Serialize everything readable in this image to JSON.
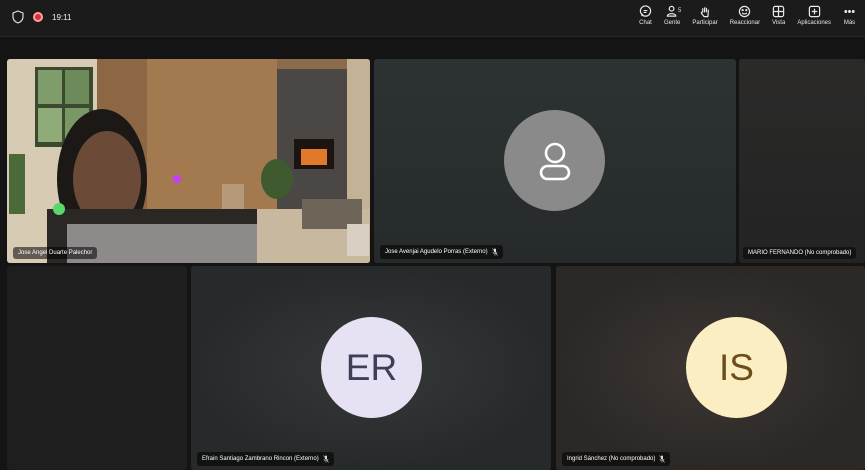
{
  "status": {
    "time": "19:11"
  },
  "toolbar": {
    "items": [
      {
        "label": "Chat",
        "icon": "chat-icon"
      },
      {
        "label": "Gente",
        "icon": "people-icon",
        "count": "5"
      },
      {
        "label": "Participar",
        "icon": "raise-hand-icon"
      },
      {
        "label": "Reaccionar",
        "icon": "react-icon"
      },
      {
        "label": "Vista",
        "icon": "view-icon"
      },
      {
        "label": "Aplicaciones",
        "icon": "apps-icon"
      },
      {
        "label": "Más",
        "icon": "more-icon"
      }
    ]
  },
  "participants": [
    {
      "name": "Jose Angel Duarte Palechor",
      "type": "video"
    },
    {
      "name": "Jose Avenjai Agudelo Porras (Externo)",
      "type": "placeholder"
    },
    {
      "name": "MARIO FERNANDO (No comprobado)",
      "type": "dark"
    },
    {
      "name": "Efrain Santiago Zambrano Rincon (Externo)",
      "initials": "ER",
      "avatar_bg": "#e6e2f4",
      "initials_color": "#3e3e58"
    },
    {
      "name": "Ingrid Sánchez (No comprobado)",
      "initials": "IS",
      "avatar_bg": "#fbeec3",
      "initials_color": "#6b4e1a"
    }
  ]
}
